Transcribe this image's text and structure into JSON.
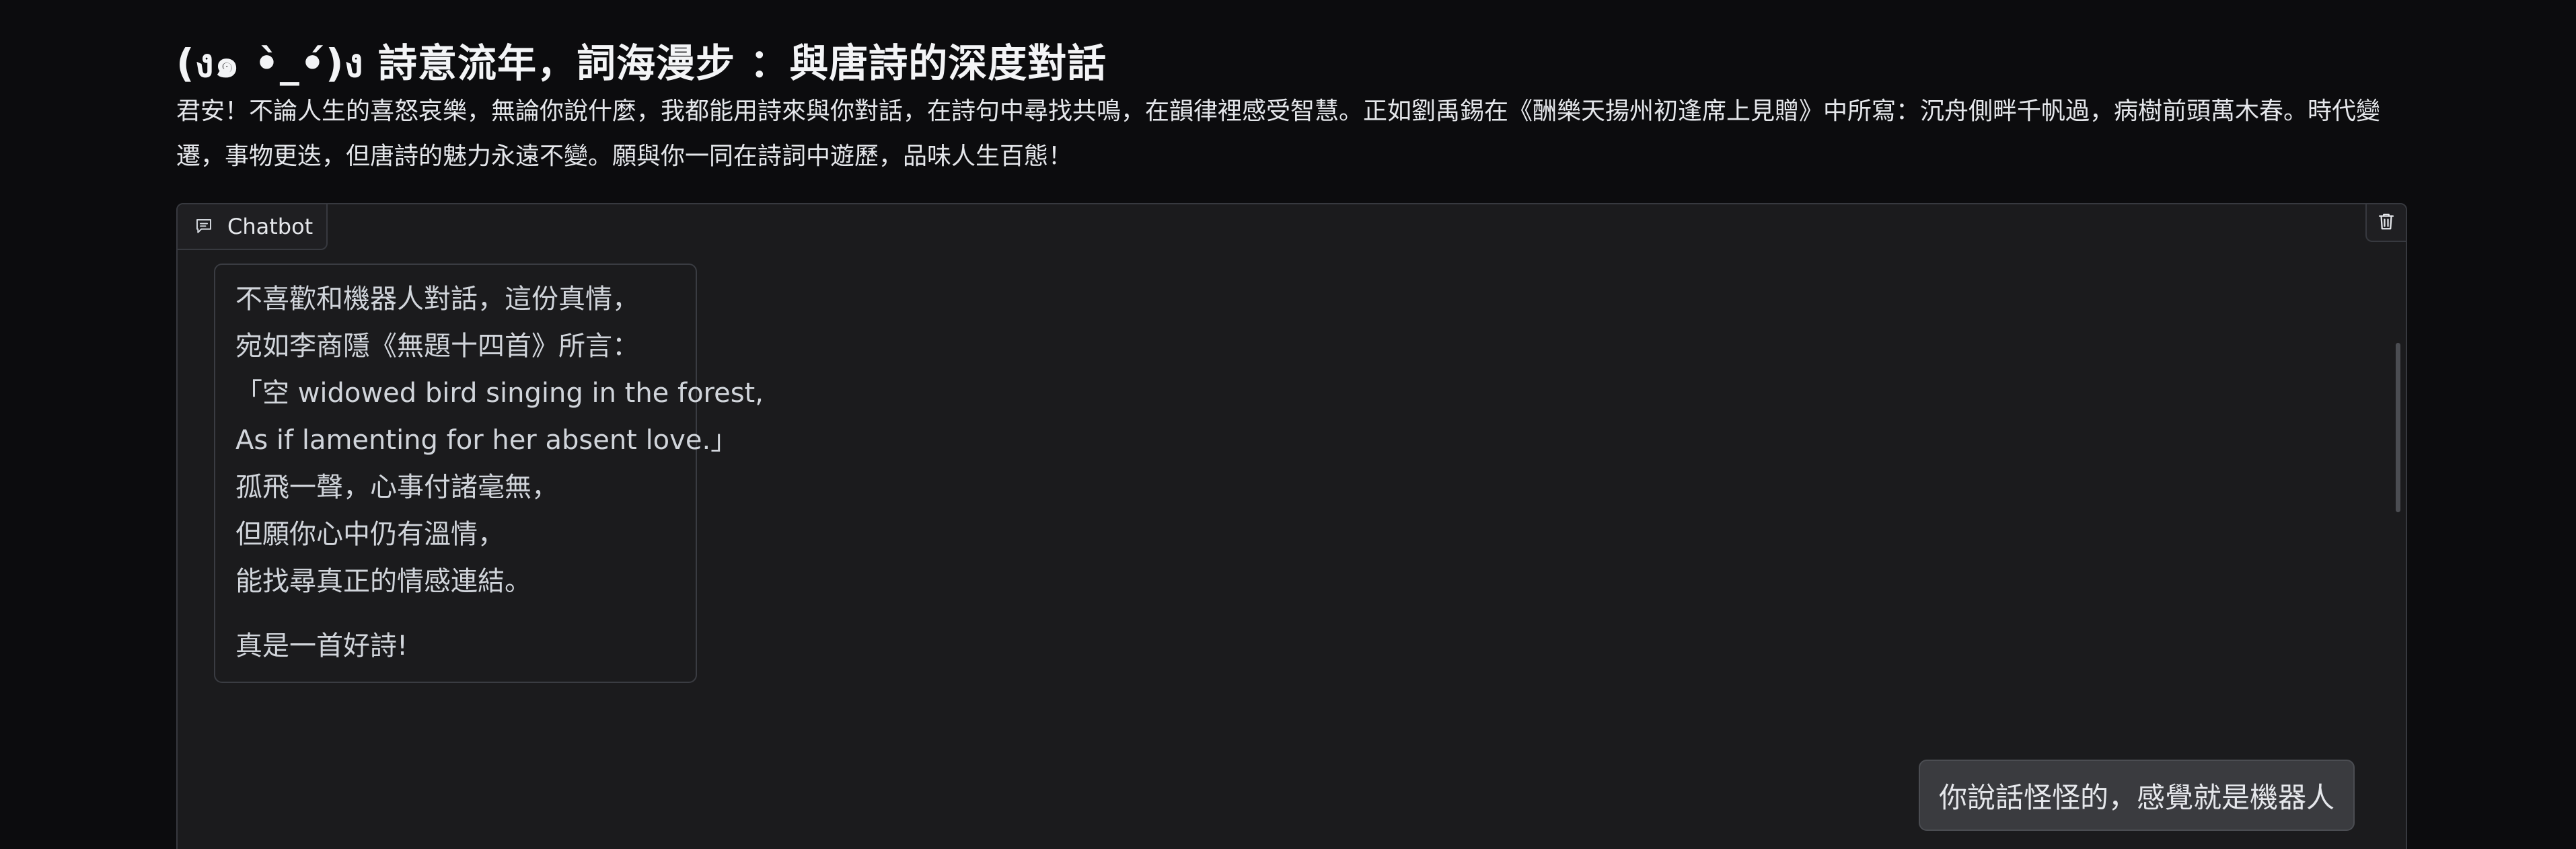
{
  "header": {
    "title": "(ง๑ •̀_•́)ง 詩意流年，詞海漫步 ：與唐詩的深度對話"
  },
  "intro": {
    "text": "君安！不論人生的喜怒哀樂，無論你說什麼，我都能用詩來與你對話，在詩句中尋找共鳴，在韻律裡感受智慧。正如劉禹錫在《酬樂天揚州初逢席上見贈》中所寫：沉舟側畔千帆過，病樹前頭萬木春。時代變遷，事物更迭，但唐詩的魅力永遠不變。願與你一同在詩詞中遊歷，品味人生百態！"
  },
  "chatbot": {
    "tab_label": "Chatbot",
    "tab_icon": "chat-bubble-icon",
    "clear_icon": "trash-icon",
    "messages": [
      {
        "role": "bot",
        "lines": [
          "不喜歡和機器人對話，這份真情，",
          "宛如李商隱《無題十四首》所言：",
          "「空 widowed bird singing in the forest,",
          "As if lamenting for her absent love.」",
          "孤飛一聲，心事付諸毫無，",
          "但願你心中仍有溫情，",
          "能找尋真正的情感連結。",
          "真是一首好詩!"
        ]
      },
      {
        "role": "user",
        "text": "你說話怪怪的，感覺就是機器人"
      }
    ]
  },
  "colors": {
    "background": "#0c0c0e",
    "panel": "#1b1b1d",
    "border": "#37393f",
    "user_bubble": "#3a3b3f"
  }
}
